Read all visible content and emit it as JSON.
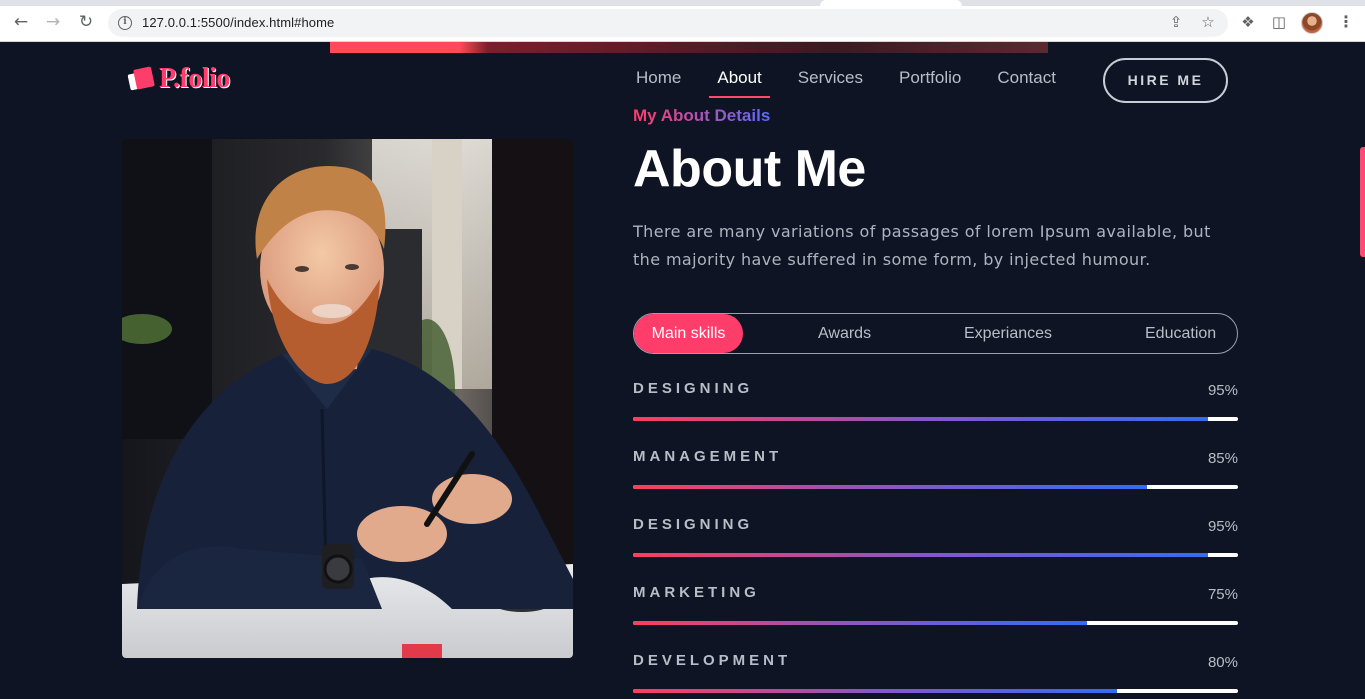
{
  "browser": {
    "url": "127.0.0.1:5500/index.html#home",
    "back_icon": "back-arrow-icon",
    "forward_icon": "forward-arrow-icon",
    "reload_icon": "reload-icon"
  },
  "site": {
    "logo_text": "P.folio",
    "nav": [
      "Home",
      "About",
      "Services",
      "Portfolio",
      "Contact"
    ],
    "active_nav": "About",
    "hire_label": "HIRE ME"
  },
  "about": {
    "subtitle": "My About Details",
    "title": "About Me",
    "description": "There are many variations of passages of lorem Ipsum available, but the majority have suffered in some form, by injected humour."
  },
  "tabs": [
    "Main skills",
    "Awards",
    "Experiances",
    "Education"
  ],
  "skills": [
    {
      "name": "DESIGNING",
      "percent_label": "95%",
      "value": 95
    },
    {
      "name": "MANAGEMENT",
      "percent_label": "85%",
      "value": 85
    },
    {
      "name": "DESIGNING",
      "percent_label": "95%",
      "value": 95
    },
    {
      "name": "MARKETING",
      "percent_label": "75%",
      "value": 75
    },
    {
      "name": "DEVELOPMENT",
      "percent_label": "80%",
      "value": 80
    }
  ],
  "colors": {
    "accent": "#ff3d6a",
    "background": "#0e1423",
    "gradient_end": "#2f6ff0"
  }
}
